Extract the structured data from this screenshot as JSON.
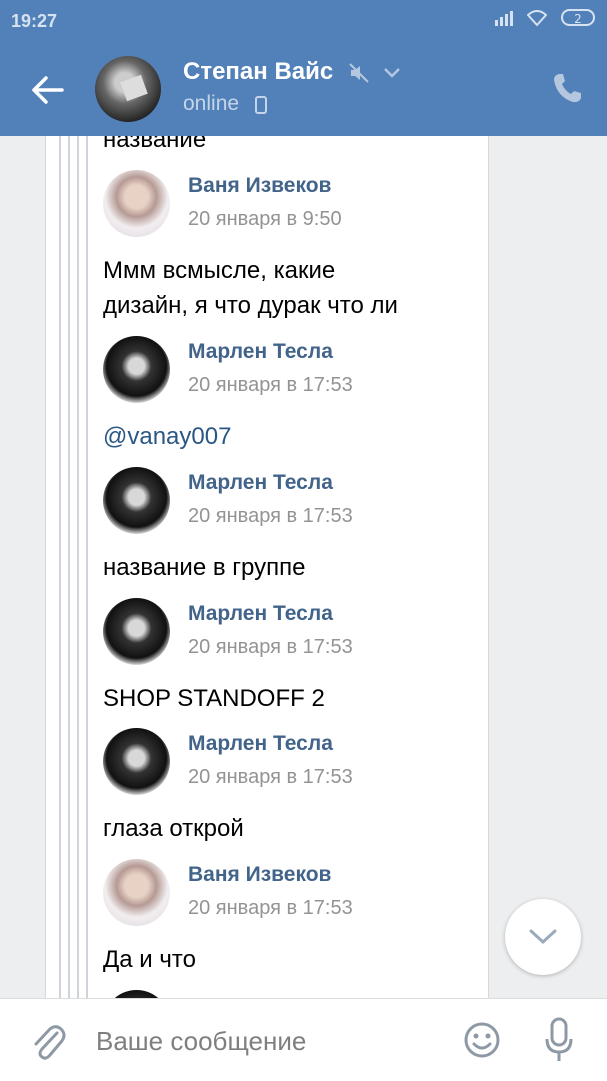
{
  "status_bar": {
    "time": "19:27",
    "battery": "2"
  },
  "header": {
    "peer_name": "Степан Вайс",
    "peer_status": "online"
  },
  "forwarded": {
    "top_partial_text": "название",
    "messages": [
      {
        "author": "Ваня Извеков",
        "date": "20 января в 9:50",
        "avatar": "vanya",
        "text_lines": [
          "Ммм всмысле, какие",
          "дизайн, я что дурак что ли"
        ]
      },
      {
        "author": "Марлен Тесла",
        "date": "20 января в 17:53",
        "avatar": "marlen",
        "text_lines": [
          "@vanay007"
        ]
      },
      {
        "author": "Марлен Тесла",
        "date": "20 января в 17:53",
        "avatar": "marlen",
        "text_lines": [
          "название в группе"
        ]
      },
      {
        "author": "Марлен Тесла",
        "date": "20 января в 17:53",
        "avatar": "marlen",
        "text_lines": [
          "SHOP STANDOFF 2"
        ]
      },
      {
        "author": "Марлен Тесла",
        "date": "20 января в 17:53",
        "avatar": "marlen",
        "text_lines": [
          "глаза открой"
        ]
      },
      {
        "author": "Ваня Извеков",
        "date": "20 января в 17:53",
        "avatar": "vanya",
        "text_lines": [
          "Да и что"
        ]
      }
    ]
  },
  "composer": {
    "placeholder": "Ваше сообщение"
  },
  "colors": {
    "header": "#5181b8",
    "author": "#42648b",
    "mention": "#2a5885",
    "date": "#939393"
  }
}
